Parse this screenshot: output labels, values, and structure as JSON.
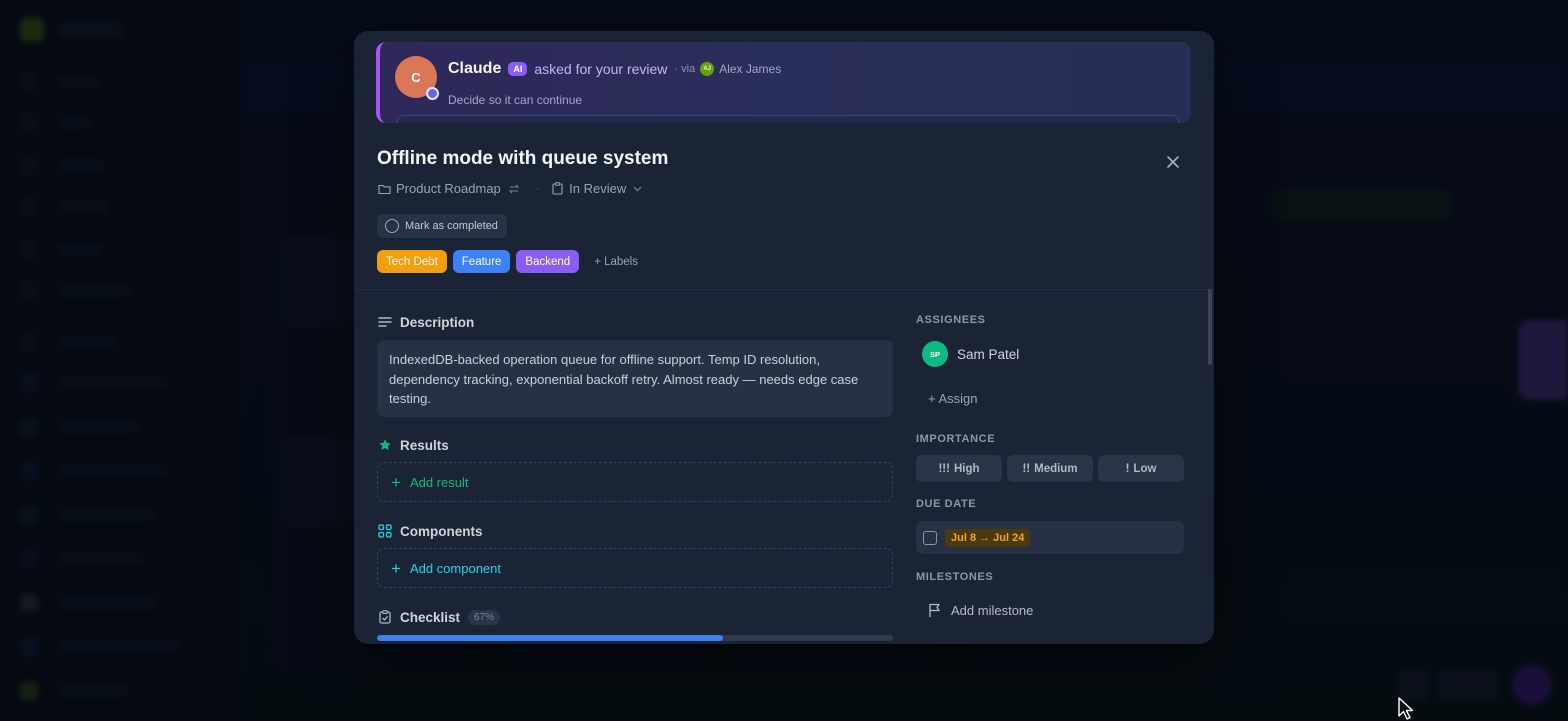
{
  "review_banner": {
    "avatar_initial": "C",
    "name": "Claude",
    "ai_badge": "AI",
    "action": "asked for your review",
    "via_label": "· via",
    "via_avatar_initials": "AJ",
    "via_name": "Alex James",
    "subtitle": "Decide so it can continue"
  },
  "task": {
    "title": "Offline mode with queue system",
    "project": "Product Roadmap",
    "status": "In Review",
    "mark_completed_label": "Mark as completed",
    "labels": [
      {
        "text": "Tech Debt",
        "color": "#f59e0b"
      },
      {
        "text": "Feature",
        "color": "#3b82f6"
      },
      {
        "text": "Backend",
        "color": "#8b5cf6"
      }
    ],
    "add_labels": "+ Labels"
  },
  "description": {
    "heading": "Description",
    "text": "IndexedDB-backed operation queue for offline support. Temp ID resolution, dependency tracking, exponential backoff retry. Almost ready — needs edge case testing."
  },
  "results": {
    "heading": "Results",
    "add_label": "Add result"
  },
  "components": {
    "heading": "Components",
    "add_label": "Add component"
  },
  "checklist": {
    "heading": "Checklist",
    "percent_label": "67%",
    "progress": 0.67
  },
  "sidebar": {
    "assignees_label": "ASSIGNEES",
    "assignee": {
      "initials": "SP",
      "name": "Sam Patel"
    },
    "assign_link": "+ Assign",
    "importance_label": "IMPORTANCE",
    "importance_options": [
      {
        "bang": "!!!",
        "text": "High"
      },
      {
        "bang": "!!",
        "text": "Medium"
      },
      {
        "bang": "!",
        "text": "Low"
      }
    ],
    "due_date_label": "DUE DATE",
    "due_date_value": "Jul 8 → Jul 24",
    "milestones_label": "MILESTONES",
    "add_milestone": "Add milestone"
  },
  "colors": {
    "accent_purple": "#a855f7",
    "results_green": "#10b981",
    "components_cyan": "#22d3ee",
    "progress_blue": "#3b82f6",
    "due_amber": "#f5a524"
  }
}
